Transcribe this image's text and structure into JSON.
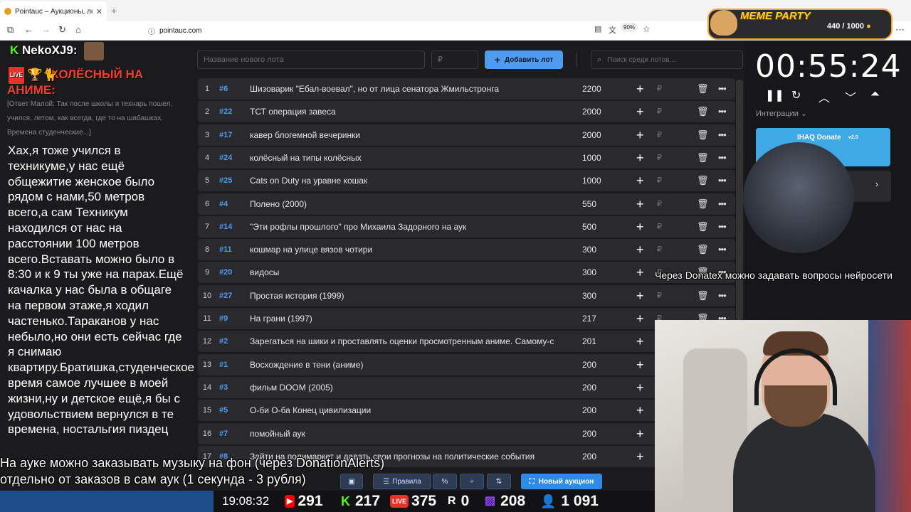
{
  "browser": {
    "tab_title": "Pointauc – Аукционы, лотереи",
    "url": "pointauc.com",
    "zoom": "90%"
  },
  "chat": {
    "username": "NekoXJ9:",
    "red_message": "КОЛЁСНЫЙ НА АНИМЕ:",
    "reply_quote": "[Ответ Малой: Так после школы я технарь пошел, учился, летом, как всегда, где то на шабашках. Времена студенческие...]",
    "message": "Хах,я тоже учился в техникуме,у нас ещё общежитие женское было рядом с нами,50 метров всего,а сам Техникум находился от нас на расстоянии 100 метров всего.Вставать можно было в 8:30 и к 9 ты уже на парах.Ещё качалка у нас была в общаге на первом этаже,я ходил частенько.Тараканов у нас небыло,но они есть сейчас где я снимаю квартиру.Братишка,студенческое время самое лучшее в моей жизни,ну и детское ещё,я бы с удовольствием вернулся в те времена, ностальгия пиздец",
    "live_badge": "LIVE"
  },
  "toolbar": {
    "lot_name_placeholder": "Название нового лота",
    "price_placeholder": "₽",
    "add_lot_label": "Добавить лот",
    "search_placeholder": "Поиск среди лотов..."
  },
  "lots": [
    {
      "num": "1",
      "id": "#6",
      "name": "Шизоварик \"Ебал-воевал\", но от лица сенатора Жмильстронга",
      "amount": "2200"
    },
    {
      "num": "2",
      "id": "#22",
      "name": "ТСТ операция завеса",
      "amount": "2000"
    },
    {
      "num": "3",
      "id": "#17",
      "name": "кавер блогемной вечеринки",
      "amount": "2000"
    },
    {
      "num": "4",
      "id": "#24",
      "name": "колёсный на типы колёсных",
      "amount": "1000"
    },
    {
      "num": "5",
      "id": "#25",
      "name": "Cats on Duty на уравне кошак",
      "amount": "1000"
    },
    {
      "num": "6",
      "id": "#4",
      "name": "Полено (2000)",
      "amount": "550"
    },
    {
      "num": "7",
      "id": "#14",
      "name": "\"Эти рофлы прошлого\" про Михаила Задорного на аук",
      "amount": "500"
    },
    {
      "num": "8",
      "id": "#11",
      "name": "кошмар на улице вязов чотири",
      "amount": "300"
    },
    {
      "num": "9",
      "id": "#20",
      "name": "видосы",
      "amount": "300"
    },
    {
      "num": "10",
      "id": "#27",
      "name": "Простая история (1999)",
      "amount": "300"
    },
    {
      "num": "11",
      "id": "#9",
      "name": "На грани (1997)",
      "amount": "217"
    },
    {
      "num": "12",
      "id": "#2",
      "name": "Зарегаться на шики и проставлять оценки просмотренным аниме. Самому-с",
      "amount": "201"
    },
    {
      "num": "13",
      "id": "#1",
      "name": "Восхождение в тени (аниме)",
      "amount": "200"
    },
    {
      "num": "14",
      "id": "#3",
      "name": "фильм DOOM (2005)",
      "amount": "200"
    },
    {
      "num": "15",
      "id": "#5",
      "name": "О-би О-ба Конец цивилизации",
      "amount": "200"
    },
    {
      "num": "16",
      "id": "#7",
      "name": "помойный аук",
      "amount": "200"
    },
    {
      "num": "17",
      "id": "#8",
      "name": "Зайти на полимаркет и давать свои прогнозы на политические события",
      "amount": "200"
    }
  ],
  "bottom_bar": {
    "rules_label": "Правила",
    "new_auction_label": "Новый аукцион"
  },
  "overlay": {
    "line1": "На ауке можно заказывать музыку на фон (через DonationAlerts)",
    "line2": "отдельно от заказов в сам аук (1 секунда - 3 рубля)",
    "neuro": "Через Donatex можно задавать вопросы нейросети"
  },
  "stats": {
    "time": "19:08:32",
    "youtube": "291",
    "kick": "217",
    "live": "375",
    "rutube": "0",
    "twitch": "208",
    "total": "1 091",
    "live_badge": "LIVE"
  },
  "timer": {
    "value": "00:55:24",
    "integrations_label": "Интеграции",
    "ihaq_label": "IHAQ Donate",
    "ihaq_version": "v2.0"
  },
  "meme_party": {
    "title": "MEME PARTY",
    "count": "440 / 1000"
  }
}
